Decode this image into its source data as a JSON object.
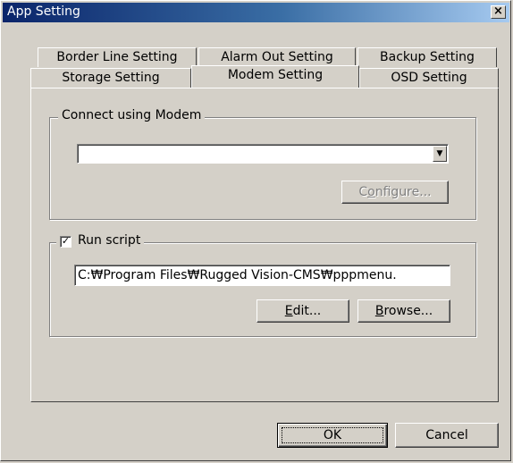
{
  "window": {
    "title": "App Setting",
    "close_label": "×"
  },
  "tabs": {
    "row_back": [
      {
        "label": "Border Line Setting"
      },
      {
        "label": "Alarm Out Setting"
      },
      {
        "label": "Backup Setting"
      }
    ],
    "row_front": [
      {
        "label": "Storage Setting",
        "active": false
      },
      {
        "label": "Modem Setting",
        "active": true
      },
      {
        "label": "OSD Setting",
        "active": false
      }
    ]
  },
  "modem_group": {
    "label": "Connect using Modem",
    "modem_select": {
      "value": "",
      "arrow": "▼"
    },
    "configure_button": {
      "label_pre": "C",
      "label_mnemonic": "o",
      "label_post": "nfigure...",
      "enabled": false
    }
  },
  "script_group": {
    "checkbox_checked": true,
    "checkbox_mark": "✓",
    "label": "Run script",
    "script_path": "C:₩Program Files₩Rugged Vision-CMS₩pppmenu.",
    "edit_button": {
      "label_mnemonic": "E",
      "label_post": "dit..."
    },
    "browse_button": {
      "label_mnemonic": "B",
      "label_post": "rowse..."
    }
  },
  "footer": {
    "ok_label": "OK",
    "cancel_label": "Cancel"
  }
}
